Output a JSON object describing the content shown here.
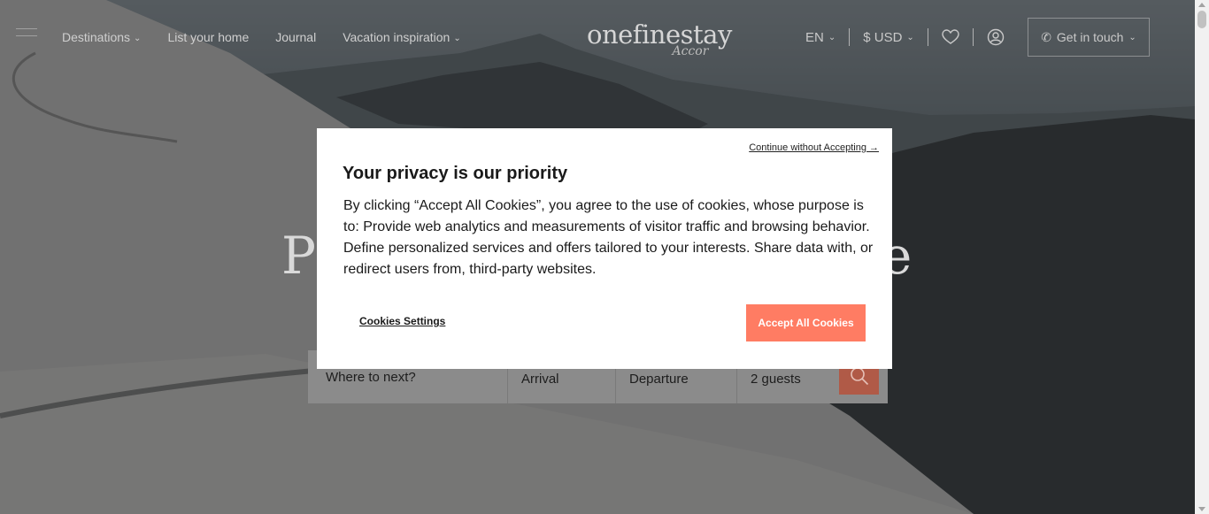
{
  "nav": {
    "items": [
      {
        "label": "Destinations",
        "has_dropdown": true
      },
      {
        "label": "List your home",
        "has_dropdown": false
      },
      {
        "label": "Journal",
        "has_dropdown": false
      },
      {
        "label": "Vacation inspiration",
        "has_dropdown": true
      }
    ],
    "logo_word": "onefinestay",
    "logo_script": "Accor",
    "language": "EN",
    "currency": "$ USD",
    "get_in_touch": "Get in touch",
    "icons": [
      "menu-icon",
      "heart-icon",
      "account-icon",
      "phone-icon",
      "search-icon"
    ]
  },
  "hero": {
    "headline_start": "P",
    "headline_end": "e"
  },
  "search": {
    "destination_placeholder": "Where to next?",
    "arrival": "Arrival",
    "departure": "Departure",
    "guests": "2 guests"
  },
  "cookie_modal": {
    "continue_link": "Continue without Accepting →",
    "title": "Your privacy is our priority",
    "body": "By clicking “Accept All Cookies”, you agree to the use of cookies, whose purpose is to: Provide web analytics and measurements of visitor traffic and browsing behavior. Define personalized services and offers tailored to your interests. Share data with, or redirect users from, third-party websites.",
    "settings_label": "Cookies Settings",
    "accept_label": "Accept All Cookies",
    "accent_color": "#ff7c63"
  }
}
